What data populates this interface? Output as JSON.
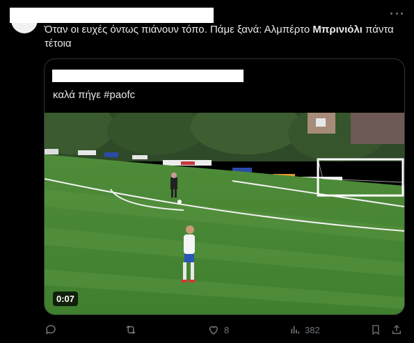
{
  "tweet": {
    "text_plain": "Όταν οι ευχές όντως πιάνουν τόπο. Πάμε ξανά: Αλμπέρτο ",
    "text_bold": "Μπρινιόλι",
    "text_tail": " πάντα τέτοια"
  },
  "quote": {
    "text": "καλά πήγε #paofc",
    "video_duration": "0:07"
  },
  "actions": {
    "reply_count": "",
    "repost_count": "",
    "like_count": "8",
    "views_count": "382"
  },
  "icons": {
    "more": "more-horizontal-icon",
    "reply": "reply-icon",
    "repost": "repost-icon",
    "like": "heart-icon",
    "views": "views-icon",
    "bookmark": "bookmark-icon",
    "share": "share-icon"
  },
  "colors": {
    "background": "#000000",
    "text": "#e7e9ea",
    "muted": "#71767b",
    "border": "#2f3336"
  }
}
